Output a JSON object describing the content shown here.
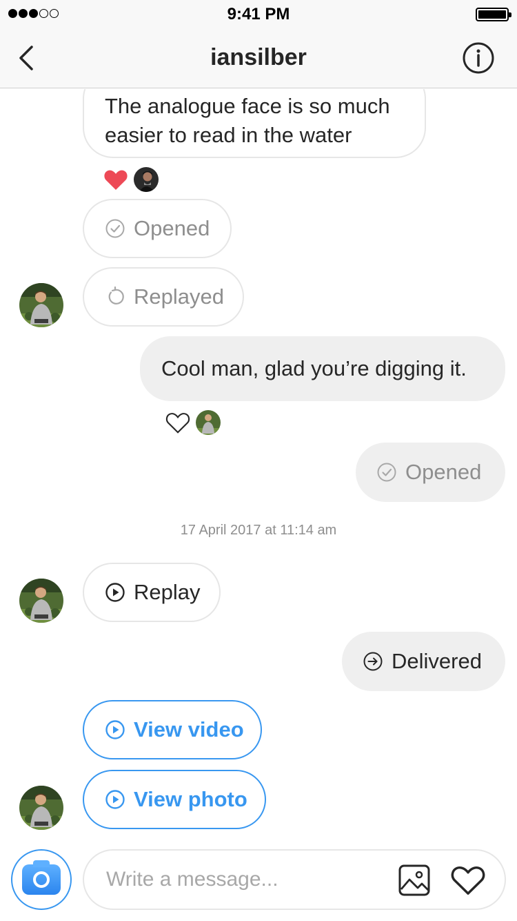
{
  "status_bar": {
    "time": "9:41 PM"
  },
  "header": {
    "title": "iansilber"
  },
  "messages": {
    "m1_text": "The analogue face is so much easier to read in the water",
    "m2_label": "Opened",
    "m3_label": "Replayed",
    "m4_text": "Cool man, glad you’re digging it.",
    "m5_label": "Opened",
    "timestamp": "17 April 2017 at 11:14 am",
    "m6_label": "Replay",
    "m7_label": "Delivered",
    "m8_label": "View video",
    "m9_label": "View photo"
  },
  "composer": {
    "placeholder": "Write a message..."
  },
  "colors": {
    "accent": "#3897f0",
    "like_red": "#ed4956",
    "gray_text": "#8e8e8e"
  },
  "icons": [
    "back-icon",
    "info-icon",
    "heart-icon",
    "check-circle-icon",
    "replay-icon",
    "play-icon",
    "arrow-circle-icon",
    "camera-icon",
    "gallery-icon"
  ]
}
